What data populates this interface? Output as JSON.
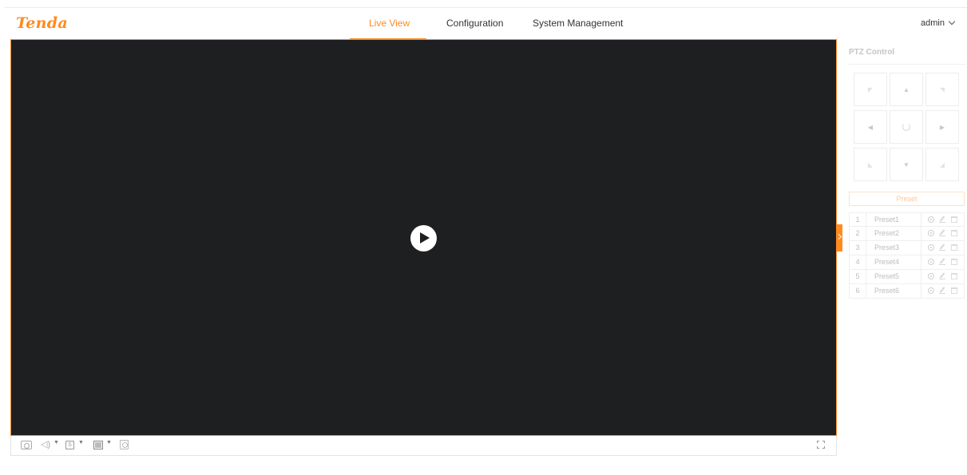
{
  "header": {
    "logo": "Tenda",
    "nav": [
      {
        "label": "Live View",
        "active": true
      },
      {
        "label": "Configuration",
        "active": false
      },
      {
        "label": "System Management",
        "active": false
      }
    ],
    "user": "admin"
  },
  "colors": {
    "accent": "#ff8a1f",
    "video_bg": "#1e1f21"
  },
  "video": {
    "play_icon": "play-icon"
  },
  "toolbar": {
    "icons": [
      "snapshot-icon",
      "sound-icon",
      "stream-icon",
      "window-layout-icon",
      "digital-zoom-icon",
      "fullscreen-icon"
    ]
  },
  "ptz": {
    "title": "PTZ Control",
    "preset_header": "Preset",
    "presets": [
      {
        "index": "1",
        "name": "Preset1"
      },
      {
        "index": "2",
        "name": "Preset2"
      },
      {
        "index": "3",
        "name": "Preset3"
      },
      {
        "index": "4",
        "name": "Preset4"
      },
      {
        "index": "5",
        "name": "Preset5"
      },
      {
        "index": "6",
        "name": "Preset6"
      }
    ],
    "direction_glyphs": {
      "up_left": "◤",
      "up": "▲",
      "up_right": "◥",
      "left": "◀",
      "right": "▶",
      "down_left": "◣",
      "down": "▼",
      "down_right": "◢"
    }
  }
}
